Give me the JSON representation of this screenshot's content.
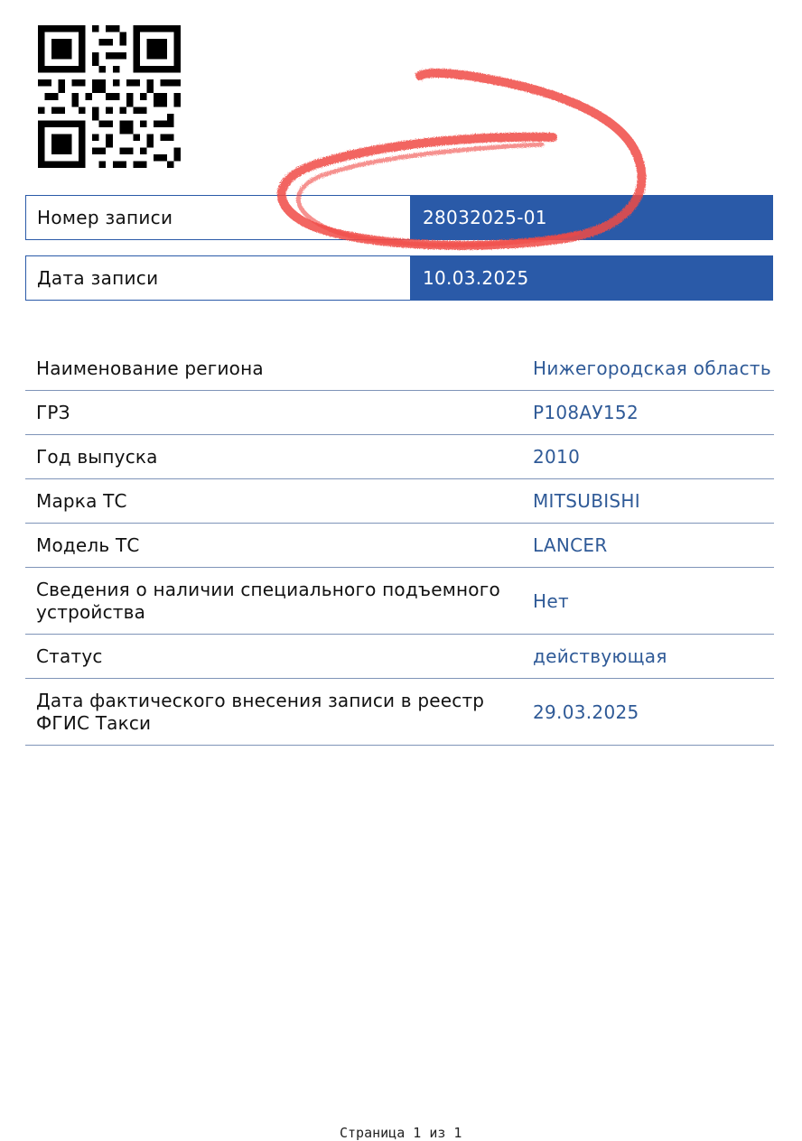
{
  "record_number": {
    "label": "Номер записи",
    "value": "28032025-01"
  },
  "record_date": {
    "label": "Дата записи",
    "value": "10.03.2025"
  },
  "details": [
    {
      "label": "Наименование региона",
      "value": "Нижегородская область"
    },
    {
      "label": "ГРЗ",
      "value": "Р108АУ152"
    },
    {
      "label": "Год выпуска",
      "value": "2010"
    },
    {
      "label": "Марка ТС",
      "value": "MITSUBISHI"
    },
    {
      "label": "Модель ТС",
      "value": "LANCER"
    },
    {
      "label": "Сведения о наличии специального подъемного устройства",
      "value": "Нет"
    },
    {
      "label": "Статус",
      "value": "действующая"
    },
    {
      "label": "Дата фактического внесения записи в реестр ФГИС Такси",
      "value": "29.03.2025"
    }
  ],
  "footer": "Страница 1 из 1",
  "colors": {
    "accent": "#2a5aa8",
    "value_text": "#2f5a97",
    "scribble": "#f04a45"
  }
}
